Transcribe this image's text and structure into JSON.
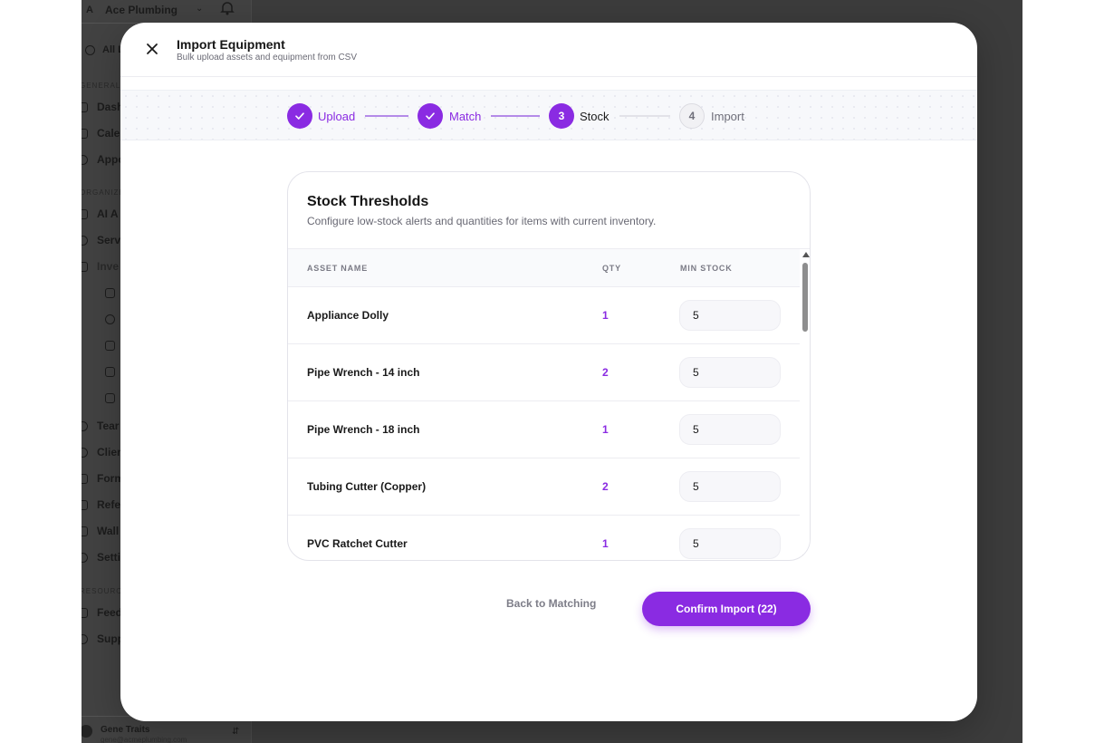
{
  "background_app": {
    "org_initial": "A",
    "org_name": "Ace Plumbing",
    "bell_icon": "bell-icon",
    "user_name": "Gene Traits",
    "user_email": "gene@acmeplumbing.com"
  },
  "modal": {
    "title": "Import Equipment",
    "subtitle": "Bulk upload assets and equipment from CSV",
    "close_icon": "close-icon"
  },
  "stepper": {
    "steps": [
      {
        "number": "1",
        "label": "Upload",
        "state": "done"
      },
      {
        "number": "2",
        "label": "Match",
        "state": "done"
      },
      {
        "number": "3",
        "label": "Stock",
        "state": "active"
      },
      {
        "number": "4",
        "label": "Import",
        "state": "pending"
      }
    ]
  },
  "stock": {
    "title": "Stock Thresholds",
    "subtitle": "Configure low-stock alerts and quantities for items with current inventory.",
    "columns": {
      "name": "ASSET NAME",
      "qty": "QTY",
      "min_stock": "MIN STOCK"
    },
    "rows": [
      {
        "name": "Appliance Dolly",
        "qty": "1",
        "min_stock": "5"
      },
      {
        "name": "Pipe Wrench - 14 inch",
        "qty": "2",
        "min_stock": "5"
      },
      {
        "name": "Pipe Wrench - 18 inch",
        "qty": "1",
        "min_stock": "5"
      },
      {
        "name": "Tubing Cutter (Copper)",
        "qty": "2",
        "min_stock": "5"
      },
      {
        "name": "PVC Ratchet Cutter",
        "qty": "1",
        "min_stock": "5"
      }
    ]
  },
  "actions": {
    "back_label": "Back to Matching",
    "confirm_label": "Confirm Import (22)"
  },
  "colors": {
    "accent": "#8a2be2",
    "overlay": "#3c3c3c"
  }
}
